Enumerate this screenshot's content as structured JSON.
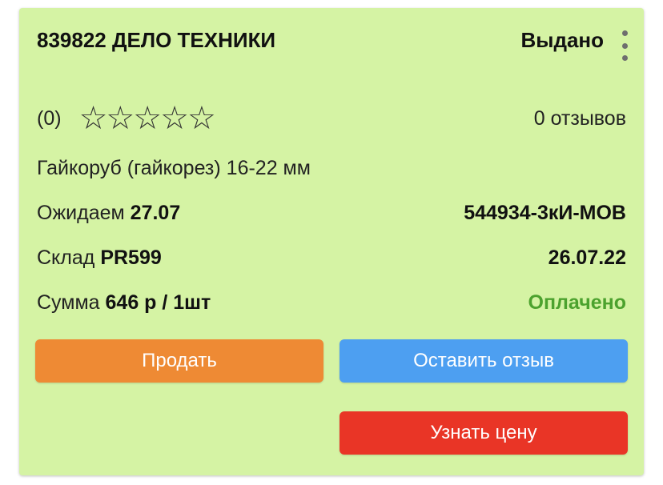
{
  "card": {
    "title": "839822 ДЕЛО ТЕХНИКИ",
    "status": "Выдано",
    "rating": {
      "count_label": "(0)",
      "stars_filled": 0,
      "stars_total": 5,
      "reviews_label": "0 отзывов"
    },
    "product_name": "Гайкоруб (гайкорез) 16-22 мм",
    "expected": {
      "label": "Ожидаем",
      "value": "27.07"
    },
    "order_code": "544934-3кИ-МОВ",
    "warehouse": {
      "label": "Склад",
      "value": "PR599"
    },
    "date": "26.07.22",
    "sum": {
      "label": "Сумма",
      "value": "646 р / 1шт"
    },
    "payment_status": "Оплачено",
    "buttons": {
      "sell": "Продать",
      "review": "Оставить отзыв",
      "price": "Узнать цену"
    }
  },
  "colors": {
    "card_bg": "#d5f3a4",
    "sell_button": "#ee8a34",
    "review_button": "#4d9ff1",
    "price_button": "#e93526",
    "paid_text": "#4ca22e"
  },
  "icons": {
    "menu": "more-vertical-icon",
    "star_empty": "star-outline-icon"
  }
}
